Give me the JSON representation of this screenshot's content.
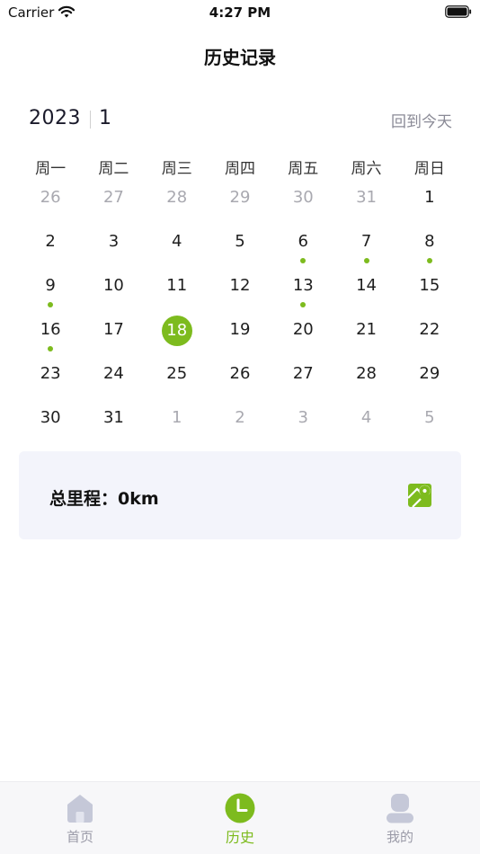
{
  "status_bar": {
    "carrier": "Carrier",
    "time": "4:27 PM"
  },
  "nav": {
    "title": "历史记录"
  },
  "calendar": {
    "year": "2023",
    "month": "1",
    "today_button": "回到今天",
    "weekdays": [
      "周一",
      "周二",
      "周三",
      "周四",
      "周五",
      "周六",
      "周日"
    ],
    "weeks": [
      [
        {
          "n": "26",
          "muted": true
        },
        {
          "n": "27",
          "muted": true
        },
        {
          "n": "28",
          "muted": true
        },
        {
          "n": "29",
          "muted": true
        },
        {
          "n": "30",
          "muted": true
        },
        {
          "n": "31",
          "muted": true
        },
        {
          "n": "1"
        }
      ],
      [
        {
          "n": "2"
        },
        {
          "n": "3"
        },
        {
          "n": "4"
        },
        {
          "n": "5"
        },
        {
          "n": "6",
          "dot": true
        },
        {
          "n": "7",
          "dot": true
        },
        {
          "n": "8",
          "dot": true
        }
      ],
      [
        {
          "n": "9",
          "dot": true
        },
        {
          "n": "10"
        },
        {
          "n": "11"
        },
        {
          "n": "12"
        },
        {
          "n": "13",
          "dot": true
        },
        {
          "n": "14"
        },
        {
          "n": "15"
        }
      ],
      [
        {
          "n": "16",
          "dot": true
        },
        {
          "n": "17"
        },
        {
          "n": "18",
          "selected": true
        },
        {
          "n": "19"
        },
        {
          "n": "20"
        },
        {
          "n": "21"
        },
        {
          "n": "22"
        }
      ],
      [
        {
          "n": "23"
        },
        {
          "n": "24"
        },
        {
          "n": "25"
        },
        {
          "n": "26"
        },
        {
          "n": "27"
        },
        {
          "n": "28"
        },
        {
          "n": "29"
        }
      ],
      [
        {
          "n": "30"
        },
        {
          "n": "31"
        },
        {
          "n": "1",
          "muted": true
        },
        {
          "n": "2",
          "muted": true
        },
        {
          "n": "3",
          "muted": true
        },
        {
          "n": "4",
          "muted": true
        },
        {
          "n": "5",
          "muted": true
        }
      ]
    ]
  },
  "summary": {
    "label": "总里程：",
    "value": "0km",
    "icon": "map-pin-icon"
  },
  "tab_bar": {
    "tabs": [
      {
        "label": "首页",
        "icon": "home-icon",
        "active": false
      },
      {
        "label": "历史",
        "icon": "clock-icon",
        "active": true
      },
      {
        "label": "我的",
        "icon": "user-icon",
        "active": false
      }
    ]
  },
  "colors": {
    "accent": "#7dbb1e",
    "muted_text": "#a9a9b0",
    "card_bg": "#f3f4fb",
    "inactive_icon": "#c5c8d8"
  }
}
